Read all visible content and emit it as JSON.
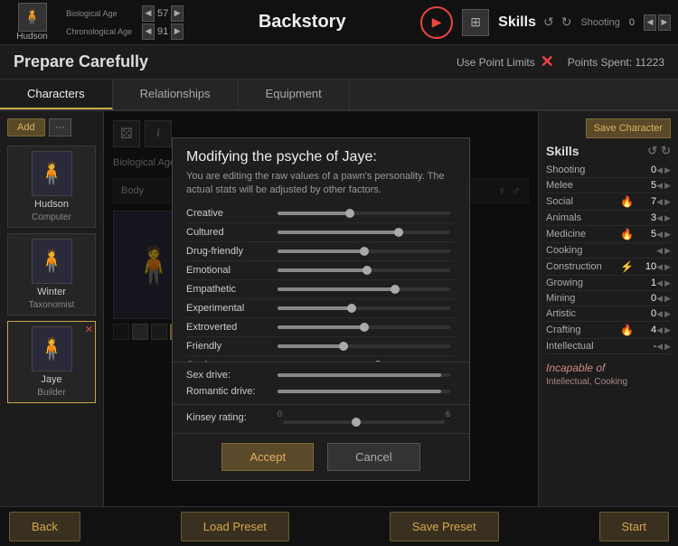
{
  "topBar": {
    "character": "Hudson",
    "bioAgeLabel": "Biological Age",
    "chronoAgeLabel": "Chronological Age",
    "bioAge": "57",
    "chronoAge": "91",
    "sectionTitle": "Backstory",
    "skillsLabel": "Skills",
    "skillsSubLabel": "Shooting",
    "skillsVal": "0"
  },
  "prepare": {
    "title": "Prepare Carefully",
    "usePointLimits": "Use Point Limits",
    "pointsSpent": "Points Spent: 11223"
  },
  "tabs": [
    {
      "label": "Characters",
      "active": true
    },
    {
      "label": "Relationships",
      "active": false
    },
    {
      "label": "Equipment",
      "active": false
    }
  ],
  "sidebar": {
    "addLabel": "Add",
    "characters": [
      {
        "name": "Hudson",
        "role": "Computer",
        "emoji": "🧍",
        "selected": false
      },
      {
        "name": "Winter",
        "role": "Taxonomist",
        "emoji": "🧍",
        "selected": false
      },
      {
        "name": "Jaye",
        "role": "Builder",
        "emoji": "🧍",
        "selected": true,
        "hasDelete": true
      }
    ]
  },
  "modal": {
    "title": "Modifying the psyche of Jaye:",
    "subtitle": "You are editing the raw values of a pawn's personality. The actual stats will be adjusted by other factors.",
    "traits": [
      {
        "name": "Creative",
        "fill": 42,
        "thumbPos": 42
      },
      {
        "name": "Cultured",
        "fill": 70,
        "thumbPos": 70
      },
      {
        "name": "Drug-friendly",
        "fill": 50,
        "thumbPos": 50
      },
      {
        "name": "Emotional",
        "fill": 52,
        "thumbPos": 52
      },
      {
        "name": "Empathetic",
        "fill": 68,
        "thumbPos": 68
      },
      {
        "name": "Experimental",
        "fill": 43,
        "thumbPos": 43
      },
      {
        "name": "Extroverted",
        "fill": 50,
        "thumbPos": 50
      },
      {
        "name": "Friendly",
        "fill": 38,
        "thumbPos": 38
      },
      {
        "name": "Geeky",
        "fill": 58,
        "thumbPos": 58
      }
    ],
    "drives": [
      {
        "label": "Sex drive:",
        "fill": 95,
        "thumbPos": 95
      },
      {
        "label": "Romantic drive:",
        "fill": 95,
        "thumbPos": 95
      }
    ],
    "kinseyLabel": "Kinsey rating:",
    "kinseyMin": "0",
    "kinseyMax": "6",
    "kinseyThumb": 3,
    "acceptLabel": "Accept",
    "cancelLabel": "Cancel"
  },
  "rightPanel": {
    "saveCharLabel": "Save Character",
    "skillsTitle": "Skills",
    "skills": [
      {
        "name": "Shooting",
        "val": "0",
        "icon": ""
      },
      {
        "name": "Melee",
        "val": "5",
        "icon": ""
      },
      {
        "name": "Social",
        "val": "7",
        "icon": "🔥"
      },
      {
        "name": "Animals",
        "val": "3",
        "icon": ""
      },
      {
        "name": "Medicine",
        "val": "5",
        "icon": "🔥"
      },
      {
        "name": "Cooking",
        "val": "",
        "icon": ""
      },
      {
        "name": "Construction",
        "val": "10",
        "icon": "⚡"
      },
      {
        "name": "Growing",
        "val": "1",
        "icon": ""
      },
      {
        "name": "Mining",
        "val": "0",
        "icon": ""
      },
      {
        "name": "Artistic",
        "val": "0",
        "icon": ""
      },
      {
        "name": "Crafting",
        "val": "4",
        "icon": "🔥"
      },
      {
        "name": "Intellectual",
        "val": "-",
        "icon": ""
      }
    ],
    "incapableTitle": "Incapable of",
    "incapableText": "Intellectual, Cooking"
  },
  "footer": {
    "backLabel": "Back",
    "loadPresetLabel": "Load Preset",
    "savePresetLabel": "Save Preset",
    "startLabel": "Start"
  },
  "body": {
    "bioAgeLabel": "Biological Age",
    "bioAge": "57",
    "bodyLabel": "Body",
    "genderSymbols": "♀ ♂"
  }
}
